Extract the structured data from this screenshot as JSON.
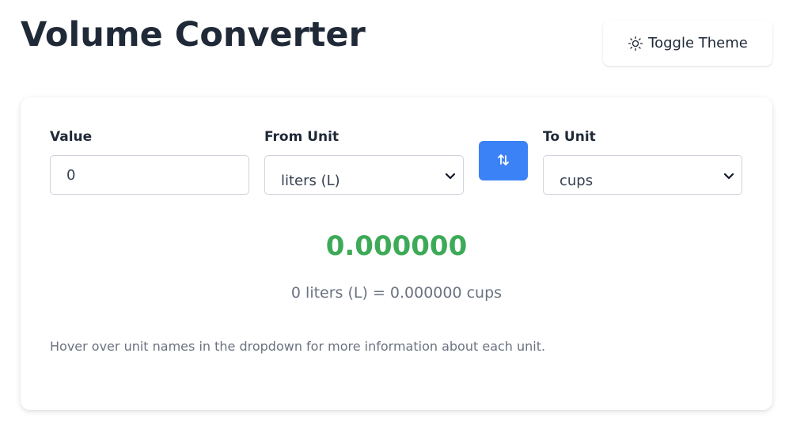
{
  "header": {
    "title": "Volume Converter",
    "theme_button_label": "Toggle Theme",
    "theme_icon": "sun-icon"
  },
  "form": {
    "value_label": "Value",
    "value": "0",
    "from_label": "From Unit",
    "from_selected": "liters (L)",
    "to_label": "To Unit",
    "to_selected": "cups",
    "swap_icon": "swap-arrows-icon"
  },
  "result": {
    "value": "0.000000",
    "equation": "0 liters (L) = 0.000000 cups"
  },
  "hint": "Hover over unit names in the dropdown for more information about each unit.",
  "colors": {
    "accent": "#3b82f6",
    "result": "#3daa57",
    "title": "#1f2937"
  }
}
